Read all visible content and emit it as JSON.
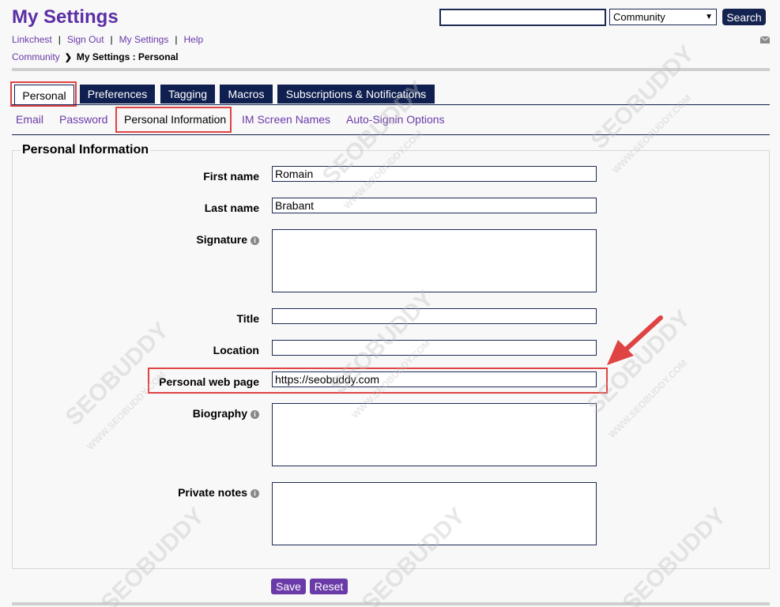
{
  "page": {
    "title": "My Settings"
  },
  "top_links": [
    "Linkchest",
    "Sign Out",
    "My Settings",
    "Help"
  ],
  "breadcrumb": {
    "root": "Community",
    "current": "My Settings : Personal"
  },
  "search": {
    "value": "",
    "scope": "Community",
    "button_label": "Search"
  },
  "tabs": [
    {
      "label": "Personal",
      "active": true
    },
    {
      "label": "Preferences",
      "active": false
    },
    {
      "label": "Tagging",
      "active": false
    },
    {
      "label": "Macros",
      "active": false
    },
    {
      "label": "Subscriptions & Notifications",
      "active": false
    }
  ],
  "subtabs": [
    {
      "label": "Email",
      "active": false
    },
    {
      "label": "Password",
      "active": false
    },
    {
      "label": "Personal Information",
      "active": true
    },
    {
      "label": "IM Screen Names",
      "active": false
    },
    {
      "label": "Auto-Signin Options",
      "active": false
    }
  ],
  "section": {
    "title": "Personal Information"
  },
  "form": {
    "first_name": {
      "label": "First name",
      "value": "Romain"
    },
    "last_name": {
      "label": "Last name",
      "value": "Brabant"
    },
    "signature": {
      "label": "Signature",
      "value": ""
    },
    "title": {
      "label": "Title",
      "value": ""
    },
    "location": {
      "label": "Location",
      "value": ""
    },
    "web_page": {
      "label": "Personal web page",
      "value": "https://seobuddy.com"
    },
    "biography": {
      "label": "Biography",
      "value": ""
    },
    "private_notes": {
      "label": "Private notes",
      "value": ""
    }
  },
  "actions": {
    "save": "Save",
    "reset": "Reset"
  },
  "watermark": {
    "text": "SEOBUDDY",
    "subtext": "WWW.SEOBUDDY.COM"
  },
  "colors": {
    "title_purple": "#5b2ea6",
    "link_purple": "#6a3aa8",
    "tab_navy": "#0f1f4f",
    "highlight_red": "#e04343",
    "button_purple": "#6a3aa8"
  }
}
